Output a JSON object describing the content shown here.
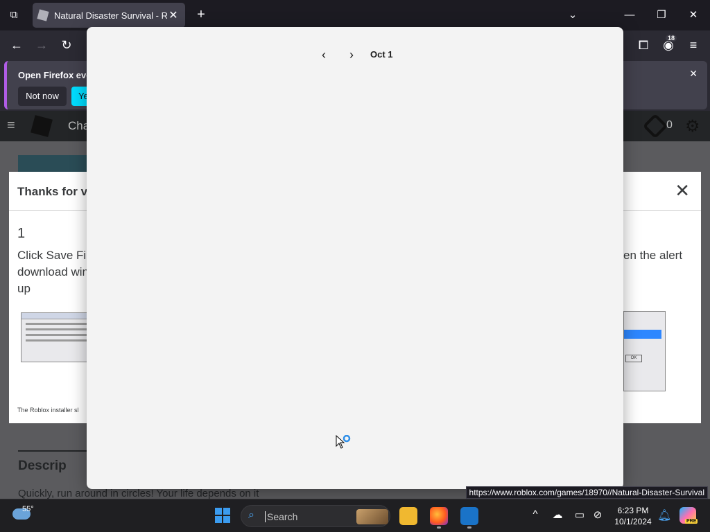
{
  "browser": {
    "tab_title": "Natural Disaster Survival - Roblox",
    "badge_count": "18",
    "notification": {
      "message": "Open Firefox every",
      "not_now": "Not now",
      "yes": "Ye"
    }
  },
  "page": {
    "header_search": "Cha",
    "robux_count": "0",
    "thanks_title": "Thanks for vis",
    "step_number": "1",
    "instructions_left": "Click Save File download win up",
    "instructions_right": "en the alert",
    "caption": "The Roblox installer sl",
    "shot_ok": "OK",
    "description_heading": "Descrip",
    "description_text": "Quickly, run around in circles! Your life depends on it"
  },
  "calendar": {
    "date_label": "Oct 1"
  },
  "status_url": "https://www.roblox.com/games/18970//Natural-Disaster-Survival",
  "taskbar": {
    "temperature": "55°",
    "search_placeholder": "Search",
    "time": "6:23 PM",
    "date": "10/1/2024",
    "copilot_tag": "PRE"
  },
  "colors": {
    "accent": "#00ddff",
    "windows_blue": "#3b9cf0",
    "flyout_bg": "#f3f3f3"
  }
}
